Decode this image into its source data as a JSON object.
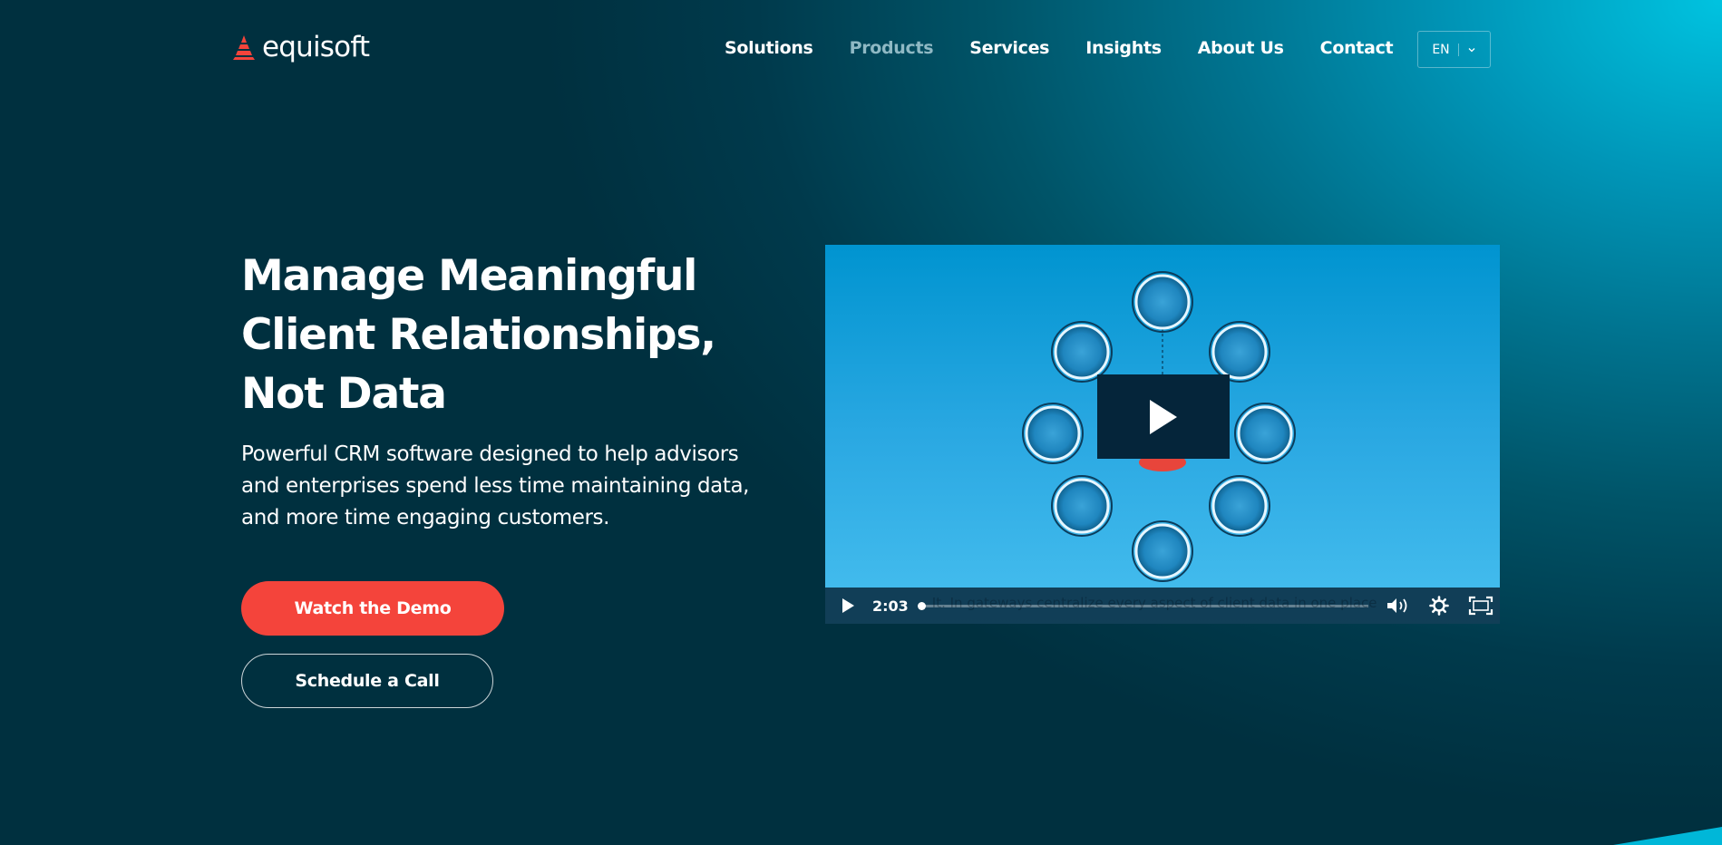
{
  "brand": {
    "name": "equisoft",
    "accent": "#f4443b"
  },
  "nav": {
    "items": [
      {
        "label": "Solutions",
        "state": "normal"
      },
      {
        "label": "Products",
        "state": "active"
      },
      {
        "label": "Services",
        "state": "normal"
      },
      {
        "label": "Insights",
        "state": "normal"
      },
      {
        "label": "About Us",
        "state": "normal"
      },
      {
        "label": "Contact",
        "state": "normal"
      }
    ],
    "language": "EN"
  },
  "hero": {
    "title": "Manage Meaningful Client Relationships, Not Data",
    "subtitle": "Powerful CRM software designed to help advisors and enterprises spend less time maintaining data, and more time engaging customers.",
    "primary_cta": "Watch the Demo",
    "secondary_cta": "Schedule a Call"
  },
  "video": {
    "time": "2:03",
    "caption": "It. In gateways centralize every aspect of client data in one place",
    "progress": 0.0,
    "icons": {
      "play": "play-icon",
      "volume": "volume-icon",
      "settings": "gear-icon",
      "fullscreen": "fullscreen-icon"
    }
  }
}
